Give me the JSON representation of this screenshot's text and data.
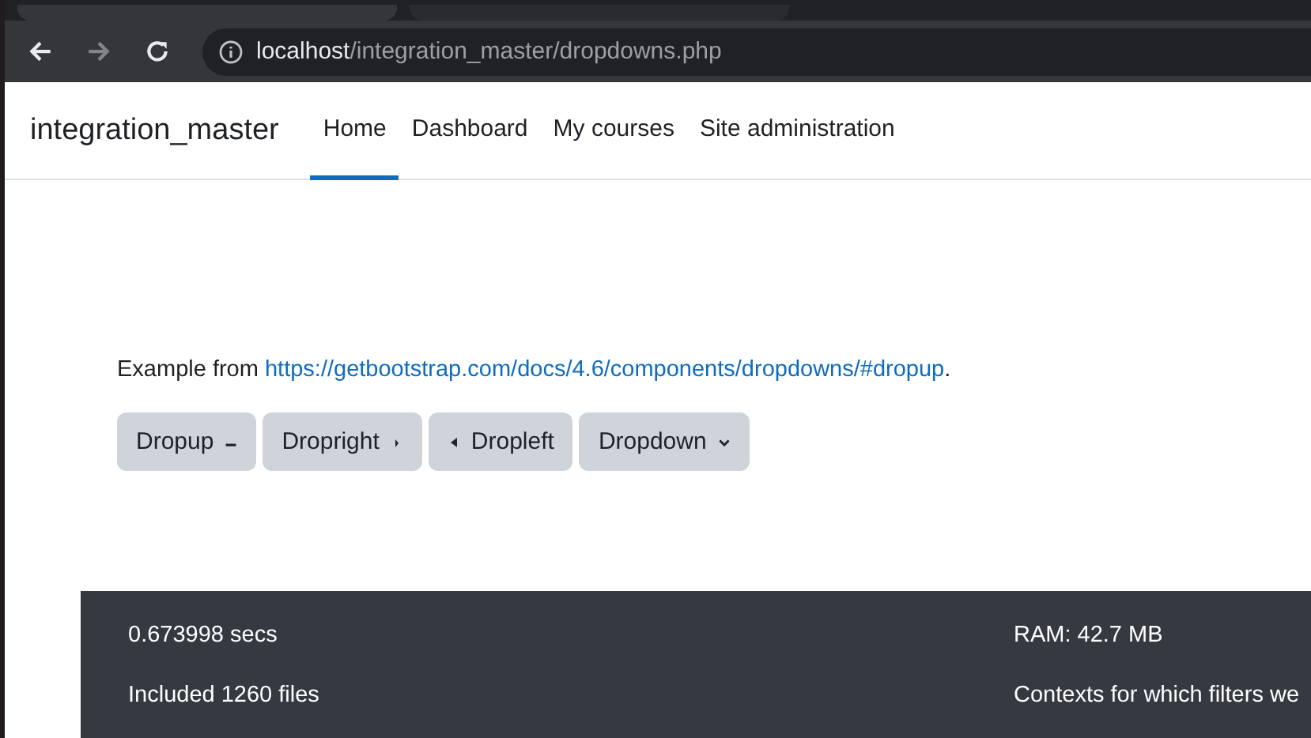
{
  "browser": {
    "url_host": "localhost",
    "url_path": "/integration_master/dropdowns.php"
  },
  "navbar": {
    "brand": "integration_master",
    "items": [
      {
        "label": "Home",
        "selected": true
      },
      {
        "label": "Dashboard",
        "selected": false
      },
      {
        "label": "My courses",
        "selected": false
      },
      {
        "label": "Site administration",
        "selected": false
      }
    ]
  },
  "intro": {
    "text": "Example from ",
    "link": "https://getbootstrap.com/docs/4.6/components/dropdowns/#dropup",
    "end": "."
  },
  "buttons": [
    {
      "label": "Dropup",
      "kind": "up"
    },
    {
      "label": "Dropright",
      "kind": "right"
    },
    {
      "label": "Dropleft",
      "kind": "left"
    },
    {
      "label": "Dropdown",
      "kind": "down"
    }
  ],
  "footer": {
    "left": [
      "0.673998 secs",
      "Included 1260 files"
    ],
    "right": [
      "RAM: 42.7 MB",
      "Contexts for which filters we"
    ]
  }
}
